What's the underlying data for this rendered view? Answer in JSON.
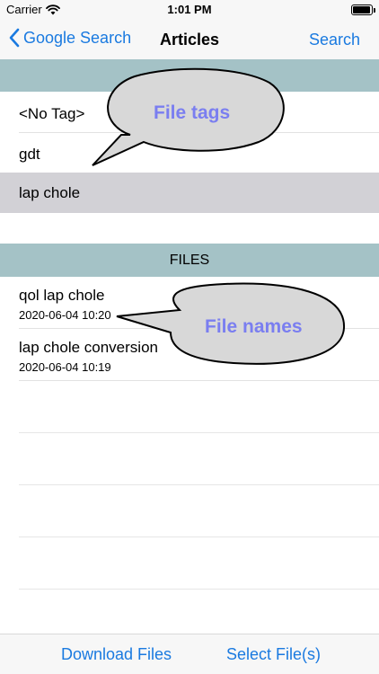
{
  "status_bar": {
    "carrier": "Carrier",
    "time": "1:01 PM"
  },
  "nav": {
    "back_label": "Google Search",
    "title": "Articles",
    "right_label": "Search"
  },
  "tags_section": {
    "header": "",
    "items": [
      {
        "label": "<No Tag>",
        "selected": false
      },
      {
        "label": "gdt",
        "selected": false
      },
      {
        "label": "lap chole",
        "selected": true
      }
    ]
  },
  "files_section": {
    "header": "FILES",
    "items": [
      {
        "name": "qol lap chole",
        "date": "2020-06-04 10:20"
      },
      {
        "name": "lap chole conversion",
        "date": "2020-06-04 10:19"
      }
    ]
  },
  "callouts": {
    "tags": "File tags",
    "names": "File names"
  },
  "toolbar": {
    "download_label": "Download Files",
    "select_label": "Select File(s)"
  },
  "colors": {
    "accent": "#1a7ae0",
    "section_header": "#a4c2c6",
    "selected_row": "#d2d1d6",
    "callout_text": "#7a7ef0",
    "callout_fill": "#d8d8d8"
  }
}
